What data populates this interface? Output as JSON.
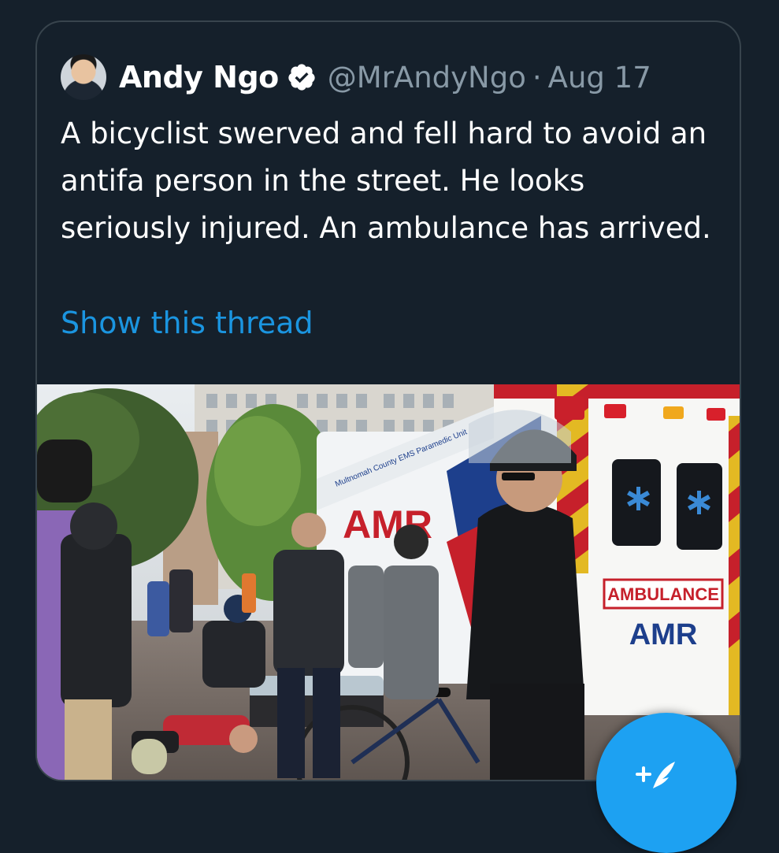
{
  "tweet": {
    "display_name": "Andy Ngo",
    "handle": "@MrAndyNgo",
    "separator": "·",
    "date": "Aug 17",
    "verified": true,
    "text": "A bicyclist swerved and fell hard to avoid an antifa person in the street. He looks seriously injured. An ambulance has arrived.",
    "show_thread_label": "Show this thread"
  },
  "media": {
    "ambulance_label": "AMBULANCE",
    "company_logo": "AMR",
    "agency_text": "Multnomah County EMS Paramedic Unit"
  },
  "compose": {
    "icon": "compose-tweet-icon"
  },
  "colors": {
    "background": "#15202b",
    "border": "#38444d",
    "text": "#ffffff",
    "muted": "#8899a6",
    "link": "#1b95e0",
    "accent": "#1da1f2"
  }
}
